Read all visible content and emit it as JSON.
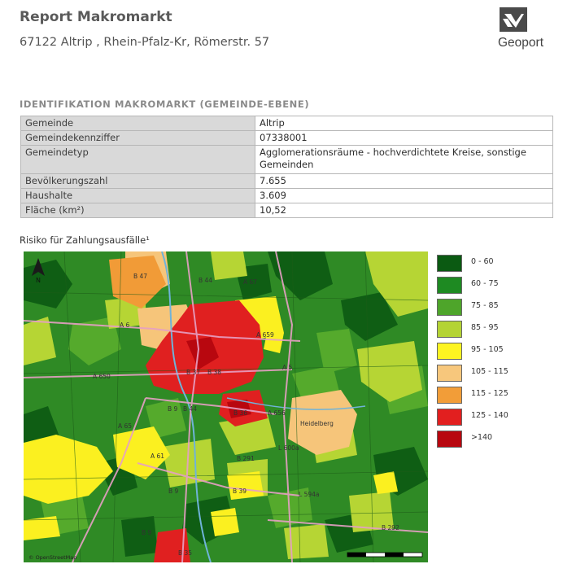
{
  "header": {
    "title": "Report Makromarkt",
    "address": "67122 Altrip , Rhein-Pfalz-Kr, Römerstr. 57",
    "logo_text": "Geoport"
  },
  "identification": {
    "section_title": "IDENTIFIKATION MAKROMARKT (GEMEINDE-EBENE)",
    "rows": [
      {
        "key": "Gemeinde",
        "value": "Altrip"
      },
      {
        "key": "Gemeindekennziffer",
        "value": "07338001"
      },
      {
        "key": "Gemeindetyp",
        "value": "Agglomerationsräume - hochverdichtete Kreise, sonstige Gemeinden"
      },
      {
        "key": "Bevölkerungszahl",
        "value": "7.655"
      },
      {
        "key": "Haushalte",
        "value": "3.609"
      },
      {
        "key": "Fläche (km²)",
        "value": "10,52"
      }
    ]
  },
  "map": {
    "title": "Risiko für Zahlungsausfälle¹",
    "attribution": "© OpenStreetMap",
    "north_label": "N",
    "road_labels": [
      "B 47",
      "B 44",
      "A 67",
      "A 6",
      "A 659",
      "A 650",
      "B 37",
      "B 38",
      "A 5",
      "B 9",
      "B 44",
      "B 36",
      "A 656",
      "Heidelberg",
      "A 65",
      "L 600a",
      "A 61",
      "B 291",
      "B 9",
      "B 39",
      "L 594a",
      "B 9",
      "B 35",
      "B 292"
    ]
  },
  "legend": {
    "items": [
      {
        "label": "0 - 60",
        "color": "#0b5a12"
      },
      {
        "label": "60 - 75",
        "color": "#1e8a22"
      },
      {
        "label": "75 - 85",
        "color": "#4ea52a"
      },
      {
        "label": "85 - 95",
        "color": "#b4d334"
      },
      {
        "label": "95 - 105",
        "color": "#fdf421"
      },
      {
        "label": "105 - 115",
        "color": "#f7c77c"
      },
      {
        "label": "115 - 125",
        "color": "#f29d38"
      },
      {
        "label": "125 - 140",
        "color": "#e21f1f"
      },
      {
        "label": ">140",
        "color": "#b8070f"
      }
    ]
  }
}
